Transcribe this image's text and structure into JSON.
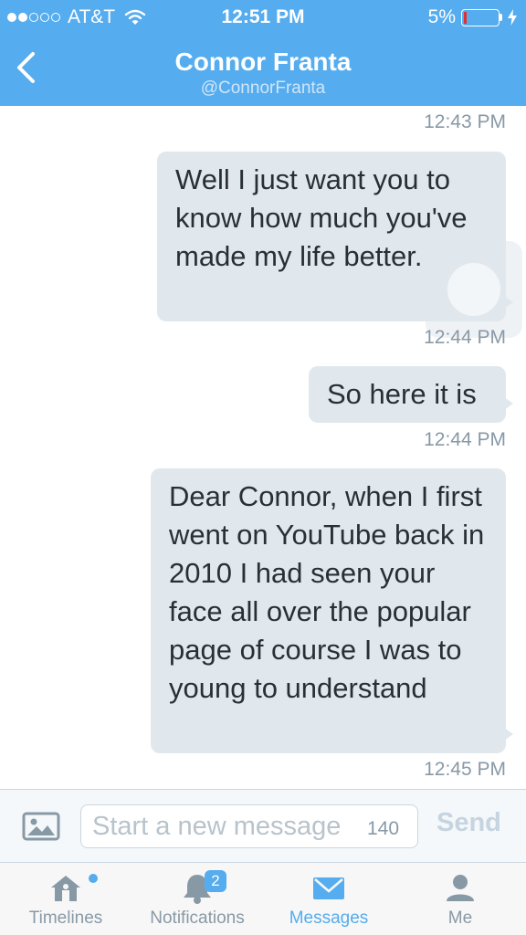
{
  "status_bar": {
    "carrier": "AT&T",
    "time": "12:51 PM",
    "battery": "5%",
    "signal_bars_filled": 2,
    "signal_bars_total": 5
  },
  "header": {
    "back_icon": "chevron-left-icon",
    "title": "Connor Franta",
    "subtitle": "@ConnorFranta"
  },
  "thread": {
    "messages": [
      {
        "time": "12:43 PM"
      },
      {
        "text": "Well I just want you to know how much you've made my life better.",
        "time": "12:44 PM"
      },
      {
        "text": "So here it is",
        "time": "12:44 PM"
      },
      {
        "text": "Dear Connor, when I first went on YouTube back in 2010 I had seen your face all over the popular page of course I was to young to understand",
        "time": "12:45 PM"
      }
    ]
  },
  "composer": {
    "photo_icon": "photo-icon",
    "placeholder": "Start a new message",
    "char_count": "140",
    "send_label": "Send"
  },
  "tabbar": {
    "tabs": [
      {
        "label": "Timelines",
        "icon": "home-icon"
      },
      {
        "label": "Notifications",
        "icon": "bell-icon",
        "badge": "2"
      },
      {
        "label": "Messages",
        "icon": "envelope-icon",
        "active": true
      },
      {
        "label": "Me",
        "icon": "person-icon"
      }
    ]
  },
  "colors": {
    "brand": "#55acee",
    "bubble": "#e1e8ed",
    "muted": "#8899a6"
  }
}
